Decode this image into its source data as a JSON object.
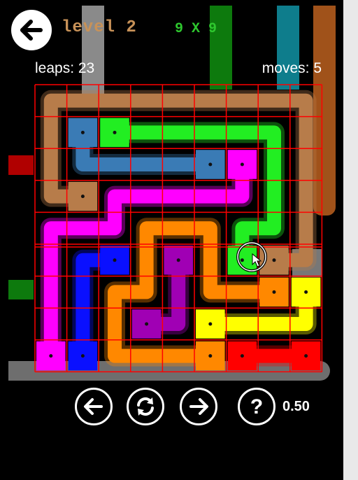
{
  "header": {
    "back_icon": "arrow-left-icon",
    "level_title": "level 2",
    "grid_size": "9 X 9"
  },
  "stats": {
    "leaps": "leaps: 23",
    "moves": "moves: 5"
  },
  "board": {
    "rows": 9,
    "cols": 9,
    "grid_color": "#ff0000",
    "endpoints": [
      {
        "color": "#3a7bb5",
        "cell": [
          1,
          1
        ]
      },
      {
        "color": "#3a7bb5",
        "cell": [
          2,
          5
        ]
      },
      {
        "color": "#22ee22",
        "cell": [
          1,
          2
        ]
      },
      {
        "color": "#22ee22",
        "cell": [
          5,
          6
        ]
      },
      {
        "color": "#ff00ff",
        "cell": [
          2,
          6
        ]
      },
      {
        "color": "#ff00ff",
        "cell": [
          8,
          0
        ]
      },
      {
        "color": "#b77c4a",
        "cell": [
          3,
          1
        ]
      },
      {
        "color": "#b77c4a",
        "cell": [
          5,
          7
        ]
      },
      {
        "color": "#0a10ff",
        "cell": [
          5,
          2
        ]
      },
      {
        "color": "#0a10ff",
        "cell": [
          8,
          1
        ]
      },
      {
        "color": "#a000b4",
        "cell": [
          5,
          4
        ]
      },
      {
        "color": "#a000b4",
        "cell": [
          7,
          3
        ]
      },
      {
        "color": "#ff8800",
        "cell": [
          6,
          7
        ]
      },
      {
        "color": "#ff8800",
        "cell": [
          8,
          5
        ]
      },
      {
        "color": "#ffff00",
        "cell": [
          6,
          8
        ]
      },
      {
        "color": "#ffff00",
        "cell": [
          7,
          5
        ]
      },
      {
        "color": "#ff0000",
        "cell": [
          8,
          6
        ]
      },
      {
        "color": "#ff0000",
        "cell": [
          8,
          8
        ]
      }
    ],
    "paths": [
      {
        "color": "#b77c4a",
        "cells": [
          [
            3,
            1
          ],
          [
            3,
            0
          ],
          [
            0,
            0
          ],
          [
            0,
            8
          ],
          [
            5,
            8
          ],
          [
            5,
            7
          ]
        ]
      },
      {
        "color": "#22ee22",
        "cells": [
          [
            1,
            2
          ],
          [
            1,
            7
          ],
          [
            4,
            7
          ],
          [
            4,
            6
          ],
          [
            5,
            6
          ]
        ]
      },
      {
        "color": "#3a7bb5",
        "cells": [
          [
            1,
            1
          ],
          [
            2,
            1
          ],
          [
            2,
            5
          ]
        ]
      },
      {
        "color": "#ff00ff",
        "cells": [
          [
            2,
            6
          ],
          [
            3,
            6
          ],
          [
            3,
            2
          ],
          [
            4,
            2
          ],
          [
            4,
            0
          ],
          [
            8,
            0
          ]
        ]
      },
      {
        "color": "#ff8800",
        "cells": [
          [
            8,
            5
          ],
          [
            8,
            2
          ],
          [
            6,
            2
          ],
          [
            6,
            3
          ],
          [
            4,
            3
          ],
          [
            4,
            5
          ],
          [
            6,
            5
          ],
          [
            6,
            7
          ]
        ]
      },
      {
        "color": "#0a10ff",
        "cells": [
          [
            5,
            2
          ],
          [
            5,
            1
          ],
          [
            8,
            1
          ]
        ]
      },
      {
        "color": "#a000b4",
        "cells": [
          [
            5,
            4
          ],
          [
            7,
            4
          ],
          [
            7,
            3
          ]
        ]
      },
      {
        "color": "#ffff00",
        "cells": [
          [
            7,
            5
          ],
          [
            7,
            8
          ],
          [
            6,
            8
          ]
        ]
      },
      {
        "color": "#ff0000",
        "cells": [
          [
            8,
            6
          ],
          [
            8,
            8
          ]
        ]
      }
    ]
  },
  "controls": {
    "undo_icon": "arrow-left-icon",
    "reset_icon": "refresh-icon",
    "redo_icon": "arrow-right-icon",
    "help_icon": "question-icon",
    "speed": "0.50"
  }
}
